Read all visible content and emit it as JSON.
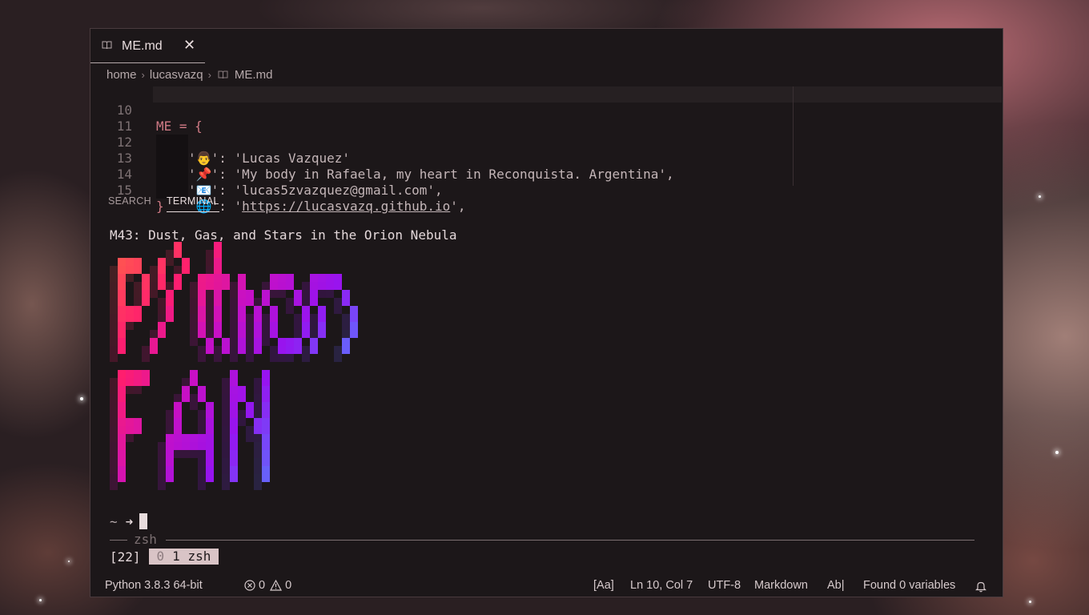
{
  "tab": {
    "filename": "ME.md",
    "file_icon": "book-icon",
    "close_icon": "close-icon"
  },
  "breadcrumb": {
    "items": [
      "home",
      "lucasvazq",
      "ME.md"
    ]
  },
  "editor": {
    "lines": [
      {
        "number": "10",
        "text": "ME = {"
      },
      {
        "number": "11",
        "key_emoji": "👨",
        "value": "'Lucas Vazquez'"
      },
      {
        "number": "12",
        "key_emoji": "📌",
        "value": "'My body in Rafaela, my heart in Reconquista. Argentina',"
      },
      {
        "number": "13",
        "key_emoji": "📧",
        "value": "'lucas5zvazquez@gmail.com',"
      },
      {
        "number": "14",
        "key_emoji": "🌐",
        "value_url": "https://lucasvazq.github.io",
        "value_tail": "',"
      },
      {
        "number": "15",
        "text": "}"
      }
    ]
  },
  "panel": {
    "tabs": [
      "SEARCH",
      "TERMINAL"
    ],
    "active": "TERMINAL"
  },
  "terminal": {
    "title": "M43: Dust, Gas, and Stars in the Orion Nebula",
    "ascii_words": [
      "Python",
      "FAN"
    ],
    "prompt_tilde": "~",
    "prompt_arrow": "➜",
    "zsh_label": "zsh",
    "tmux_session": "[22]",
    "tmux_window_index0": "0",
    "tmux_window": "1 zsh"
  },
  "colors": {
    "gradient_start": "#ff5a4e",
    "gradient_mid": "#c410c4",
    "gradient_end": "#5a78ff",
    "accent_bg": "#1c1719"
  },
  "statusbar": {
    "python": "Python 3.8.3 64-bit",
    "errors": "0",
    "warnings": "0",
    "case": "[Aa]",
    "position": "Ln 10, Col 7",
    "encoding": "UTF-8",
    "language": "Markdown",
    "ab": "Ab|",
    "variables": "Found 0 variables",
    "bell_icon": "bell-icon"
  }
}
